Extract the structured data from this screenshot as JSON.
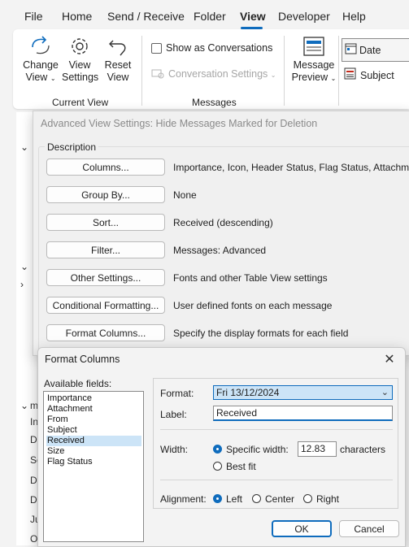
{
  "menu": {
    "tabs": [
      "File",
      "Home",
      "Send / Receive",
      "Folder",
      "View",
      "Developer",
      "Help"
    ],
    "active": "View"
  },
  "ribbon": {
    "change_view": [
      "Change",
      "View"
    ],
    "view_settings": [
      "View",
      "Settings"
    ],
    "reset_view": [
      "Reset",
      "View"
    ],
    "current_view_group": "Current View",
    "show_as_conversations": "Show as Conversations",
    "conversation_settings": "Conversation Settings",
    "messages_group": "Messages",
    "message_preview": [
      "Message",
      "Preview"
    ],
    "arrange_date": "Date",
    "arrange_subject": "Subject"
  },
  "advanced_dialog": {
    "title": "Advanced View Settings: Hide Messages Marked for Deletion",
    "legend": "Description",
    "rows": [
      {
        "button": "Columns...",
        "desc": "Importance, Icon, Header Status, Flag Status, Attachment"
      },
      {
        "button": "Group By...",
        "desc": "None"
      },
      {
        "button": "Sort...",
        "desc": "Received (descending)"
      },
      {
        "button": "Filter...",
        "desc": "Messages: Advanced"
      },
      {
        "button": "Other Settings...",
        "desc": "Fonts and other Table View settings"
      },
      {
        "button": "Conditional Formatting...",
        "desc": "User defined fonts on each message"
      },
      {
        "button": "Format Columns...",
        "desc": "Specify the display formats for each field"
      }
    ]
  },
  "format_dialog": {
    "title": "Format Columns",
    "available_fields_label": "Available fields:",
    "fields": [
      "Importance",
      "Attachment",
      "From",
      "Subject",
      "Received",
      "Size",
      "Flag Status"
    ],
    "selected_field": "Received",
    "format_label": "Format:",
    "format_value": "Fri 13/12/2024",
    "label_label": "Label:",
    "label_value": "Received",
    "width_label": "Width:",
    "specific_width": "Specific width:",
    "width_value": "12.83",
    "characters": "characters",
    "best_fit": "Best fit",
    "alignment_label": "Alignment:",
    "align_left": "Left",
    "align_center": "Center",
    "align_right": "Right",
    "ok": "OK",
    "cancel": "Cancel"
  },
  "left_nav_chars": [
    "I",
    "I",
    "I",
    "I",
    "I",
    "m",
    "In",
    "D",
    "Se",
    "D",
    "D",
    "Ju",
    "O"
  ],
  "colors": {
    "accent": "#0f6cbd",
    "selection": "#cce4f7"
  }
}
